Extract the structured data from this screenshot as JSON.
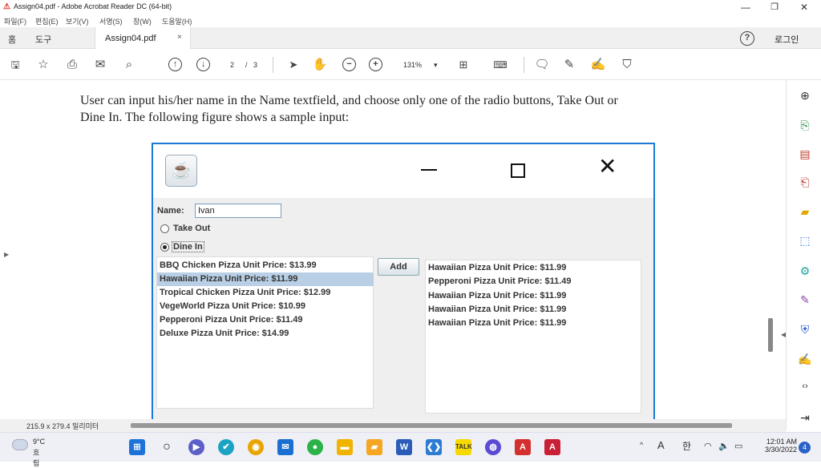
{
  "window": {
    "title": "Assign04.pdf - Adobe Acrobat Reader DC (64-bit)"
  },
  "menu": [
    "파일(F)",
    "편집(E)",
    "보기(V)",
    "서명(S)",
    "창(W)",
    "도움말(H)"
  ],
  "tabs": {
    "home": "홈",
    "tools": "도구",
    "document": "Assign04.pdf",
    "close": "×",
    "login": "로그인",
    "help": "?"
  },
  "toolbar": {
    "page_current": "2",
    "page_sep": "/",
    "page_total": "3",
    "zoom": "131%"
  },
  "document": {
    "line1": "User can input his/her name in the Name textfield, and choose only one of the radio buttons, Take Out or",
    "line2": "Dine In. The following figure shows a sample input:"
  },
  "app": {
    "name_label": "Name:",
    "name_value": "Ivan",
    "radio_takeout": "Take Out",
    "radio_dinein": "Dine In",
    "selected_option": "Dine In",
    "add_button": "Add",
    "menu_items": [
      "BBQ Chicken Pizza Unit Price: $13.99",
      "Hawaiian Pizza Unit Price: $11.99",
      "Tropical Chicken Pizza Unit Price: $12.99",
      "VegeWorld Pizza Unit Price: $10.99",
      "Pepperoni Pizza Unit Price: $11.49",
      "Deluxe Pizza Unit Price: $14.99"
    ],
    "selected_menu_index": 1,
    "order_items": [
      "Hawaiian Pizza Unit Price: $11.99",
      "Pepperoni Pizza Unit Price: $11.49",
      "Hawaiian Pizza Unit Price: $11.99",
      "Hawaiian Pizza Unit Price: $11.99",
      "Hawaiian Pizza Unit Price: $11.99"
    ]
  },
  "status": {
    "page_size": "215.9 x 279.4 밀리미터"
  },
  "taskbar": {
    "temperature": "9°C",
    "condition": "흐림",
    "time": "12:01 AM",
    "date": "3/30/2022",
    "notifications": "4",
    "lang_a": "A",
    "lang_han": "한"
  },
  "colors": {
    "accent": "#1a7ad4",
    "selection": "#b8cfe5",
    "acrobat_red": "#d32f2f"
  }
}
